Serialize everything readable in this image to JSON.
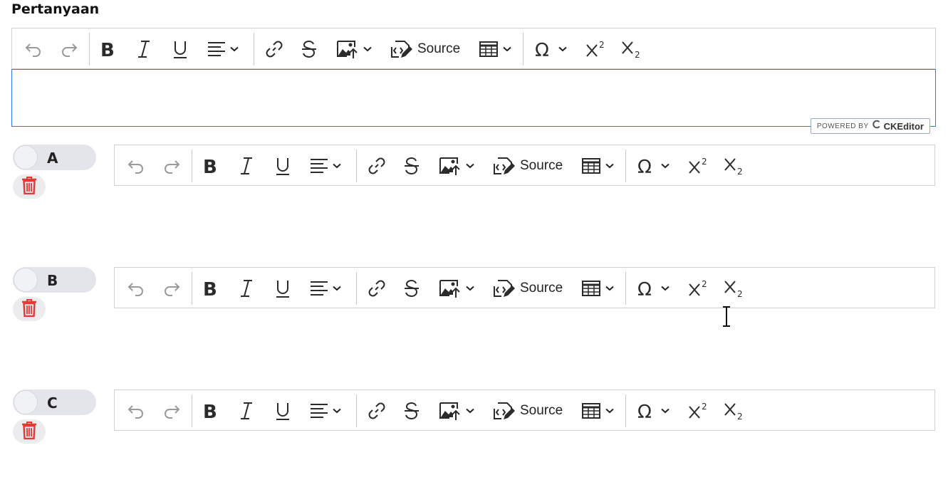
{
  "question": {
    "title": "Pertanyaan",
    "content": ""
  },
  "toolbar": {
    "items": [
      {
        "name": "undo-icon",
        "enabled": false
      },
      {
        "name": "redo-icon",
        "enabled": false
      },
      {
        "name": "bold-icon",
        "enabled": true
      },
      {
        "name": "italic-icon",
        "enabled": true
      },
      {
        "name": "underline-icon",
        "enabled": true
      },
      {
        "name": "align-icon",
        "enabled": true,
        "dropdown": true
      },
      {
        "name": "link-icon",
        "enabled": true
      },
      {
        "name": "strikethrough-icon",
        "enabled": true
      },
      {
        "name": "image-upload-icon",
        "enabled": true,
        "dropdown": true
      },
      {
        "name": "source-icon",
        "enabled": true
      },
      {
        "name": "table-icon",
        "enabled": true,
        "dropdown": true
      },
      {
        "name": "special-characters-icon",
        "enabled": true,
        "dropdown": true
      },
      {
        "name": "superscript-icon",
        "enabled": true
      },
      {
        "name": "subscript-icon",
        "enabled": true
      }
    ],
    "source_label": "Source"
  },
  "powered_by": {
    "prefix": "POWERED BY",
    "brand": "CKEditor"
  },
  "options": [
    {
      "label": "A",
      "correct": false,
      "content": ""
    },
    {
      "label": "B",
      "correct": false,
      "content": ""
    },
    {
      "label": "C",
      "correct": false,
      "content": ""
    }
  ],
  "colors": {
    "focus_border": "#2977ff",
    "delete_icon": "#e53935",
    "toggle_bg": "#e4e5ea",
    "disabled_icon": "#9a9a9a",
    "icon": "#2b2b2b"
  }
}
